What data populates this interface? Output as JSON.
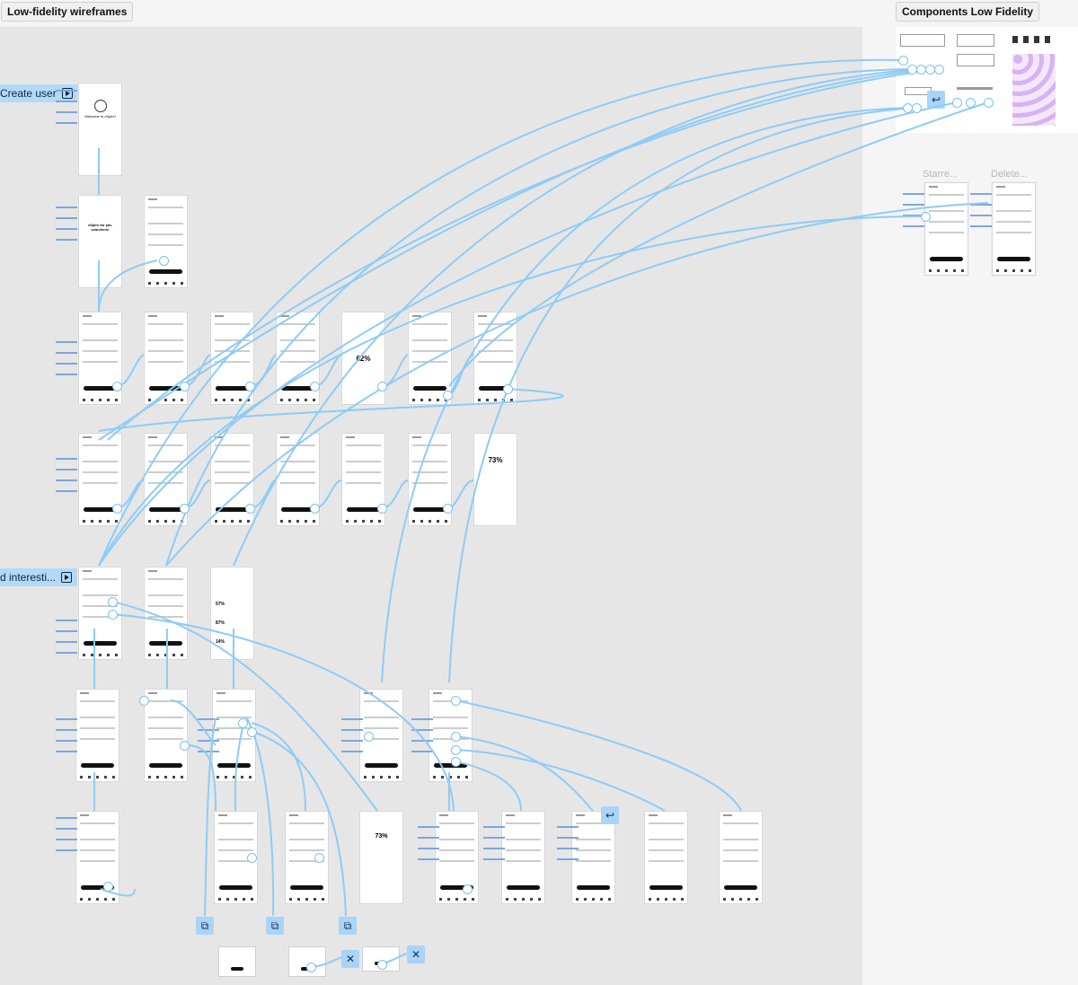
{
  "sections": {
    "main_title": "Low-fidelity wireframes",
    "components_title": "Components Low Fidelity"
  },
  "flows": {
    "create_user": "Create user",
    "find_interesting": "d interesti..."
  },
  "components": {
    "ghost_labels": [
      "Starre...",
      "Delete..."
    ]
  },
  "icons": {
    "flow_start": "play-icon",
    "back": "back-arrow-icon",
    "overlay": "overlay-icon",
    "close": "close-icon"
  },
  "screen_texts": {
    "welcome": "Welcome to xSpire!",
    "job_searchers": "xSpire for job-searchers!",
    "match_1": "62%",
    "match_2": "73%",
    "match_3": "57%",
    "match_4": "87%",
    "match_5": "14%",
    "match_6": "73%"
  },
  "colors": {
    "connector": "#8ecbf7",
    "flow_badge": "#b3d9f7",
    "canvas_section": "#e6e6e6"
  }
}
